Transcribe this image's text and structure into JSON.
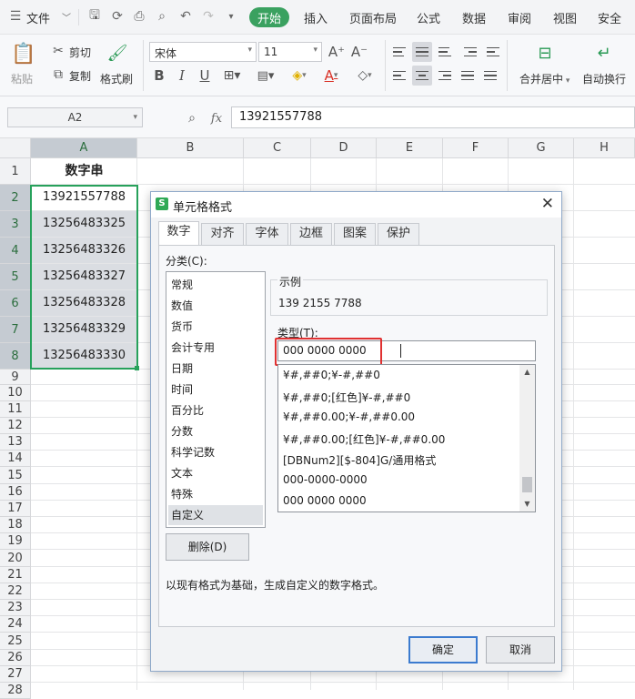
{
  "menubar": {
    "file": "文件",
    "tabs": [
      "开始",
      "插入",
      "页面布局",
      "公式",
      "数据",
      "审阅",
      "视图",
      "安全"
    ]
  },
  "ribbon": {
    "paste": "粘贴",
    "cut": "剪切",
    "copy": "复制",
    "format_painter": "格式刷",
    "font_name": "宋体",
    "font_size": "11",
    "merge_center": "合并居中",
    "wrap_text": "自动换行"
  },
  "formula_bar": {
    "cell_ref": "A2",
    "fx": "fx",
    "value": "13921557788"
  },
  "grid": {
    "columns": [
      "A",
      "B",
      "C",
      "D",
      "E",
      "F",
      "G",
      "H"
    ],
    "rows": [
      "1",
      "2",
      "3",
      "4",
      "5",
      "6",
      "7",
      "8",
      "9",
      "10",
      "11",
      "12",
      "13",
      "14",
      "15",
      "16",
      "17",
      "18",
      "19",
      "20",
      "21",
      "22",
      "23",
      "24",
      "25",
      "26",
      "27",
      "28"
    ],
    "header_cell": "数字串",
    "cells": [
      "13921557788",
      "13256483325",
      "13256483326",
      "13256483327",
      "13256483328",
      "13256483329",
      "13256483330"
    ]
  },
  "dialog": {
    "title": "单元格格式",
    "tabs": [
      "数字",
      "对齐",
      "字体",
      "边框",
      "图案",
      "保护"
    ],
    "category_label": "分类(C):",
    "categories": [
      "常规",
      "数值",
      "货币",
      "会计专用",
      "日期",
      "时间",
      "百分比",
      "分数",
      "科学记数",
      "文本",
      "特殊",
      "自定义"
    ],
    "sample_label": "示例",
    "sample_value": "139 2155 7788",
    "type_label": "类型(T):",
    "type_value": "000 0000 0000",
    "formats": [
      "¥#,##0;¥-#,##0",
      "¥#,##0;[红色]¥-#,##0",
      "¥#,##0.00;¥-#,##0.00",
      "¥#,##0.00;[红色]¥-#,##0.00",
      "[DBNum2][$-804]G/通用格式",
      "000-0000-0000",
      "000 0000 0000"
    ],
    "delete_button": "删除(D)",
    "description": "以现有格式为基础，生成自定义的数字格式。",
    "ok_button": "确定",
    "cancel_button": "取消"
  }
}
